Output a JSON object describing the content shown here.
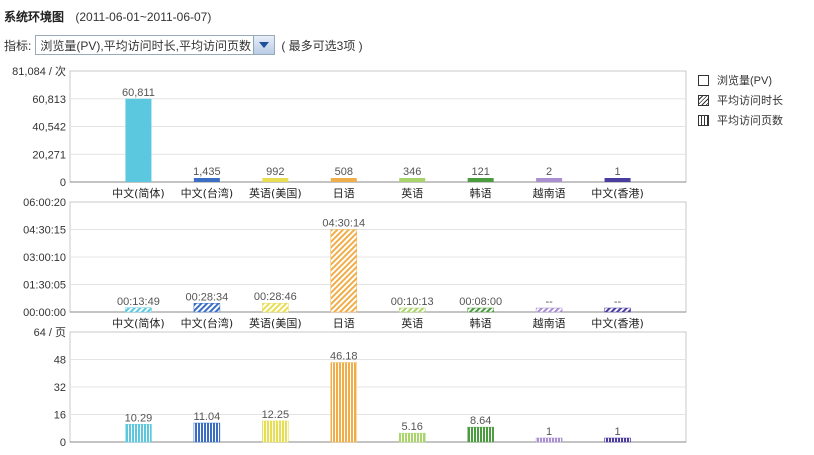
{
  "header": {
    "title": "系统环境图",
    "date_range": "(2011-06-01~2011-06-07)"
  },
  "metric_selector": {
    "label": "指标:",
    "value": "浏览量(PV),平均访问时长,平均访问页数",
    "hint": "( 最多可选3项 )"
  },
  "legend": [
    {
      "label": "浏览量(PV)",
      "pattern": "solid"
    },
    {
      "label": "平均访问时长",
      "pattern": "diagonal"
    },
    {
      "label": "平均访问页数",
      "pattern": "vertical"
    }
  ],
  "colors": [
    "#5bc8df",
    "#3a6fc4",
    "#e8de52",
    "#f0ae4a",
    "#a9d46b",
    "#4b9b3f",
    "#a98fcf",
    "#4a3da0"
  ],
  "chart_data": [
    {
      "type": "bar",
      "categories": [
        "中文(简体)",
        "中文(台湾)",
        "英语(美国)",
        "日语",
        "英语",
        "韩语",
        "越南语",
        "中文(香港)"
      ],
      "values": [
        60811,
        1435,
        992,
        508,
        346,
        121,
        2,
        1
      ],
      "value_labels": [
        "60,811",
        "1,435",
        "992",
        "508",
        "346",
        "121",
        "2",
        "1"
      ],
      "y_ticks": [
        "0",
        "20,271",
        "40,542",
        "60,813",
        "81,084 / 次"
      ],
      "ylim": [
        0,
        81084
      ],
      "pattern": "solid"
    },
    {
      "type": "bar",
      "categories": [
        "中文(简体)",
        "中文(台湾)",
        "英语(美国)",
        "日语",
        "英语",
        "韩语",
        "越南语",
        "中文(香港)"
      ],
      "values": [
        829,
        1714,
        1726,
        16214,
        613,
        480,
        0,
        0
      ],
      "value_labels": [
        "00:13:49",
        "00:28:34",
        "00:28:46",
        "04:30:14",
        "00:10:13",
        "00:08:00",
        "--",
        "--"
      ],
      "y_ticks": [
        "00:00:00",
        "01:30:05",
        "03:00:10",
        "04:30:15",
        "06:00:20"
      ],
      "ylim": [
        0,
        21620
      ],
      "pattern": "diagonal"
    },
    {
      "type": "bar",
      "categories": [
        "中文(简体)",
        "中文(台湾)",
        "英语(美国)",
        "日语",
        "英语",
        "韩语",
        "越南语",
        "中文(香港)"
      ],
      "values": [
        10.29,
        11.04,
        12.25,
        46.18,
        5.16,
        8.64,
        1,
        1
      ],
      "value_labels": [
        "10.29",
        "11.04",
        "12.25",
        "46.18",
        "5.16",
        "8.64",
        "1",
        "1"
      ],
      "y_ticks": [
        "0",
        "16",
        "32",
        "48",
        "64 / 页"
      ],
      "ylim": [
        0,
        64
      ],
      "pattern": "vertical"
    }
  ]
}
